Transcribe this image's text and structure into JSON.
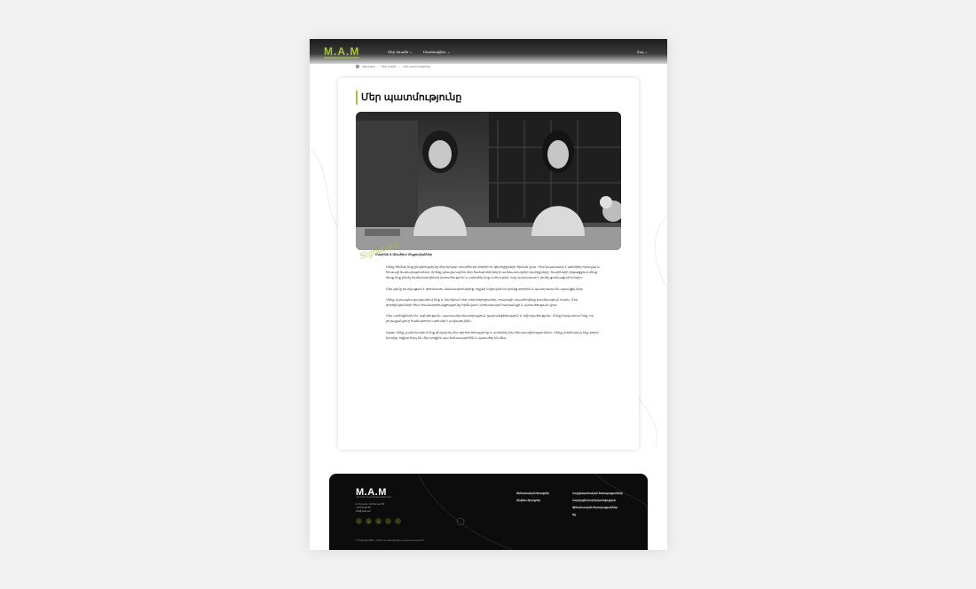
{
  "header": {
    "logo": "M.A.M",
    "nav": [
      "Մեր մասին ⌄",
      "Մասնագիտ. ⌄"
    ],
    "lang": "Հայ ⌄"
  },
  "breadcrumb": [
    "Գլխավոր",
    "›",
    "Մեր մասին",
    "›",
    "Մեր պատմությունը"
  ],
  "article": {
    "title": "Մեր պատմությունը",
    "caption": "Մարինե & Անահիտ Մելքումյաններ",
    "signature": "Signature",
    "paragraphs": [
      "Մենք հիմնել ենք ընկերությունը մեր երկար տարիների փորձի ու գիտելիքների հիման վրա։ Մեր նպատակն է ստեղծել որակյալ և հուսալի ծառայություններ, որոնք կբավարարեն մեր հաճախորդների ամենատարբեր կարիքները։ Տարիների ընթացքում մենք ձեռք ենք բերել հաճախորդների վստահություն և ստեղծել ենք ամուր թիմ, որը պատրաստ է լուծել ցանկացած խնդիր։",
      "Մեր թիմը բաղկացած է փորձառու մասնագետներից, ովքեր նվիրված են իրենց գործին և պատրաստ են աջակցել ձեզ։",
      "Մենք մշտապես զարգանում ենք և ներդնում նոր տեխնոլոգիաներ, որպեսզի ապահովենք բարձրագույն որակ։ Մեր գործընկերների հետ համագործակցությունը հիմնված է փոխադարձ հարգանքի և վստահության վրա։",
      "Մեր արժեքներն են՝ ազնվություն, պատասխանատվություն, թափանցիկություն և նվիրվածություն։ Մենք հավատում ենք, որ յուրաքանչյուր հաճախորդ արժանի է լավագույնին։",
      "Այսօր մենք շարունակում ենք ընդլայնել մեր գործունեությունը և ստեղծել նոր հնարավորություններ։ Մենք շնորհակալ ենք բոլոր նրանց, ովքեր եղել են մեր կողքին այս ճանապարհին և վստահել են մեզ։"
    ]
  },
  "footer": {
    "logo": "M.A.M",
    "logo_sub": "ՀԱՇՎԱՊԱՀԱԿԱՆ ԾԱՌԱՅՈՒԹՅՈՒՆՆԵՐ",
    "contact": [
      "Ք. Երևան, Կոմիտաս 59",
      "+374 00 00 00",
      "info@mam.am"
    ],
    "social": [
      "f",
      "◎",
      "in",
      "♪",
      "t"
    ],
    "col1": [
      "Անհատական ծրագրեր",
      "Բիզնես ծրագրեր"
    ],
    "col2": [
      "Հաշվապահական ծառայություններ",
      "Հարկային խորհրդատվություն",
      "Ֆինանսական ծառայություններ",
      "Այլ"
    ],
    "copyright": "© Copyright 2023 · Բոլոր իրավունքները պաշտպանված են"
  },
  "colors": {
    "accent": "#a4c639",
    "footer_bg": "#0c0c0c",
    "page_bg": "#f1f1f2"
  }
}
